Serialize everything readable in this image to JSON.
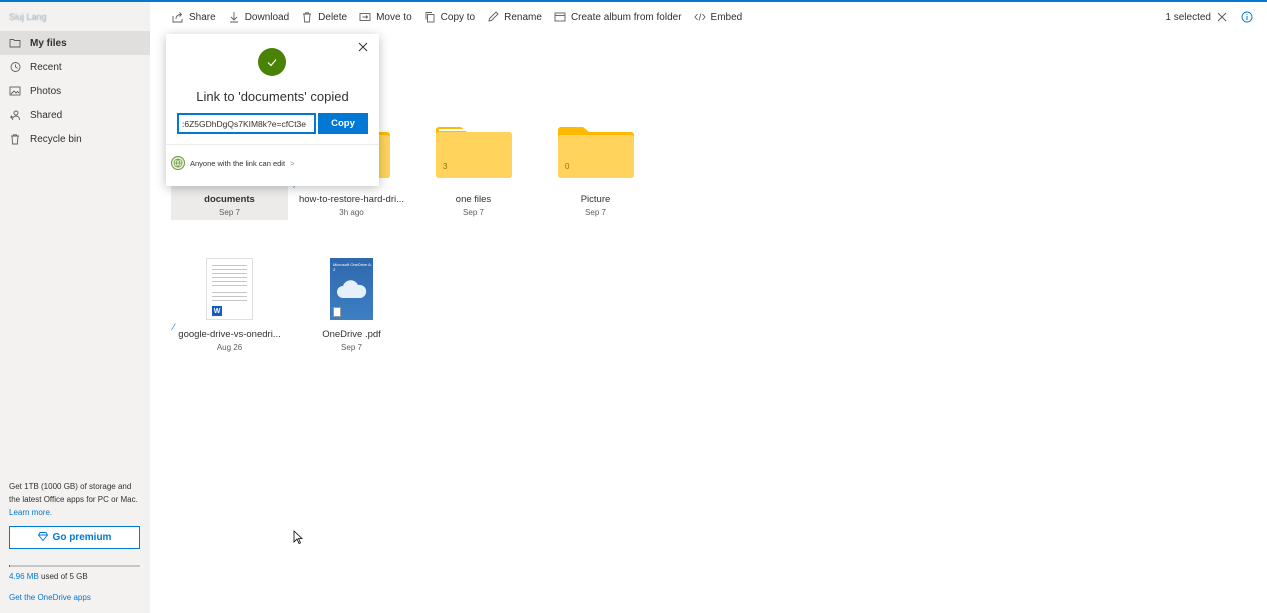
{
  "account": {
    "user_name": "Siuj Lang"
  },
  "sidebar": {
    "items": [
      {
        "label": "My files",
        "icon": "folder-icon",
        "active": true
      },
      {
        "label": "Recent",
        "icon": "history-icon",
        "active": false
      },
      {
        "label": "Photos",
        "icon": "photo-icon",
        "active": false
      },
      {
        "label": "Shared",
        "icon": "people-icon",
        "active": false
      },
      {
        "label": "Recycle bin",
        "icon": "trash-icon",
        "active": false
      }
    ],
    "premium_text": "Get 1TB (1000 GB) of storage and the latest Office apps for PC or Mac.",
    "learn_more": "Learn more.",
    "go_premium": "Go premium",
    "storage_used": "4.96 MB",
    "storage_rest": " used of 5 GB",
    "storage_fraction": 0.001,
    "get_apps": "Get the OneDrive apps"
  },
  "toolbar": {
    "share": "Share",
    "download": "Download",
    "delete": "Delete",
    "move_to": "Move to",
    "copy_to": "Copy to",
    "rename": "Rename",
    "create_album": "Create album from folder",
    "embed": "Embed",
    "selected_count": "1 selected"
  },
  "files": [
    {
      "name": "documents",
      "date": "Sep 7",
      "type": "folder",
      "selected": true
    },
    {
      "name": "how-to-restore-hard-dri...",
      "date": "3h ago",
      "type": "folder",
      "selected": false
    },
    {
      "name": "one files",
      "date": "Sep 7",
      "type": "folder",
      "count": "3",
      "selected": false
    },
    {
      "name": "Picture",
      "date": "Sep 7",
      "type": "folder",
      "count": "0",
      "selected": false
    },
    {
      "name": "google-drive-vs-onedri...",
      "date": "Aug 26",
      "type": "word",
      "selected": false
    },
    {
      "name": "OneDrive .pdf",
      "date": "Sep 7",
      "type": "pdf",
      "selected": false
    }
  ],
  "pdf_thumb_title": "Microsoft OneDrive A-Z",
  "popup": {
    "title": "Link to 'documents' copied",
    "link_value": ":6Z5GDhDgQs7KIM8k?e=cfCt3e",
    "copy_label": "Copy",
    "permission": "Anyone with the link can edit",
    "chevron": ">"
  },
  "colors": {
    "accent": "#0078d4",
    "folder": "#ffd35c",
    "folder_tab": "#ffb900",
    "success": "#498205"
  }
}
